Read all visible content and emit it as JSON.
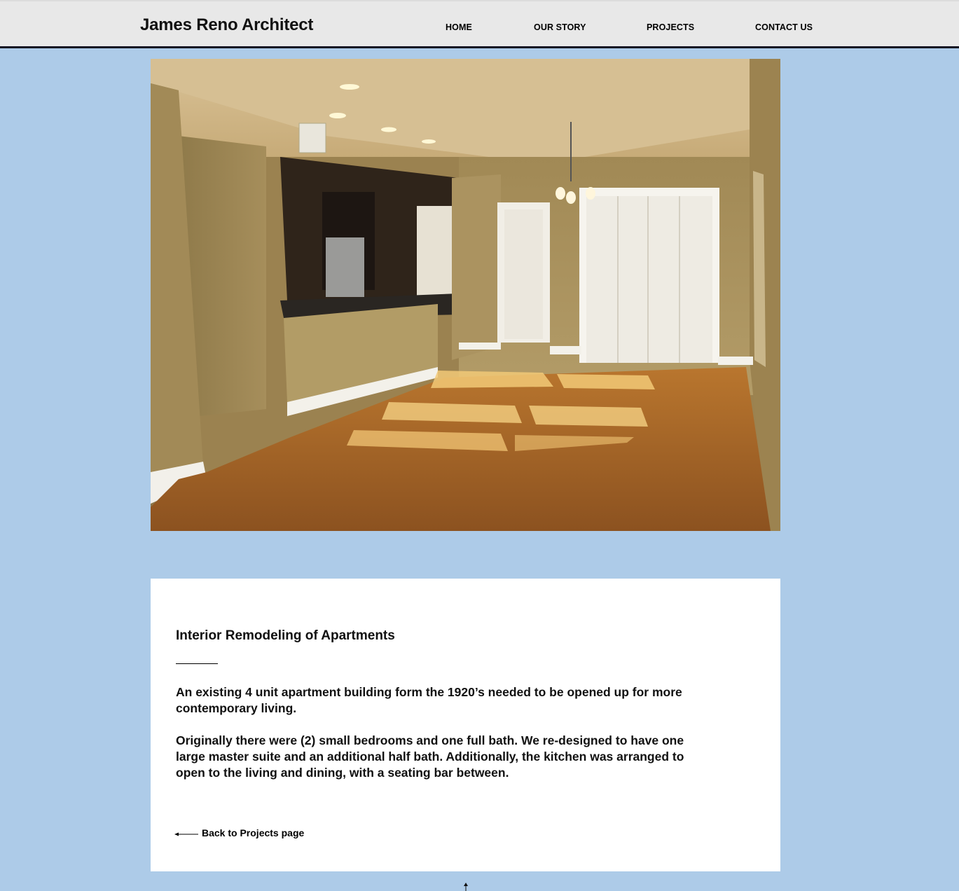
{
  "header": {
    "site_title": "James Reno Architect",
    "nav": [
      {
        "label": "HOME"
      },
      {
        "label": "OUR STORY"
      },
      {
        "label": "PROJECTS"
      },
      {
        "label": "CONTACT US"
      }
    ]
  },
  "photo": {
    "icon": "interior-photo"
  },
  "content": {
    "title": "Interior Remodeling of Apartments",
    "paragraph_1": "An existing 4 unit apartment building form the 1920’s needed to be opened up for more contemporary living.",
    "paragraph_2": "Originally there were (2) small bedrooms and one full bath. We re-designed to have one large master suite and an additional half bath. Additionally, the kitchen was arranged to open to the living and dining, with a seating bar between.",
    "back_link": "Back to Projects page"
  },
  "colors": {
    "page_bg": "#adcbe8",
    "header_bg": "#e8e8e8",
    "card_bg": "#ffffff"
  }
}
